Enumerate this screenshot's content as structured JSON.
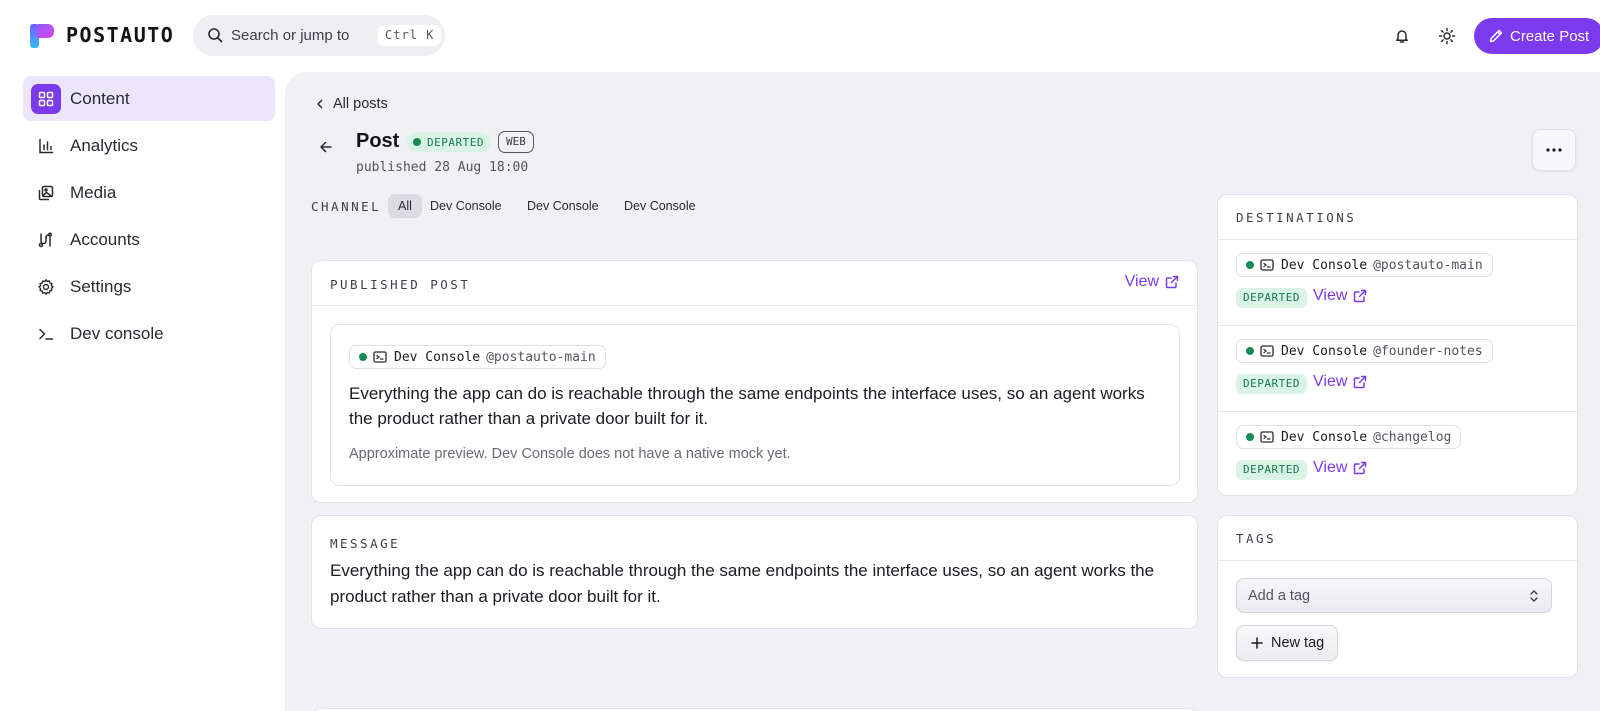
{
  "app": {
    "name": "POSTAUTO"
  },
  "search": {
    "placeholder": "Search or jump to",
    "shortcut": "Ctrl K"
  },
  "header": {
    "create_label": "Create Post",
    "accent": "#7c3aed"
  },
  "sidebar": {
    "items": [
      {
        "label": "Content",
        "icon": "grid-icon",
        "active": true
      },
      {
        "label": "Analytics",
        "icon": "bar-chart-icon"
      },
      {
        "label": "Media",
        "icon": "images-icon"
      },
      {
        "label": "Accounts",
        "icon": "accounts-icon"
      },
      {
        "label": "Settings",
        "icon": "gear-icon"
      },
      {
        "label": "Dev console",
        "icon": "terminal-icon"
      }
    ]
  },
  "post": {
    "breadcrumb": "All posts",
    "title": "Post",
    "status": "DEPARTED",
    "source": "WEB",
    "published": "published 28 Aug 18:00"
  },
  "channel": {
    "label": "CHANNEL",
    "filters": [
      "All",
      "Dev Console",
      "Dev Console",
      "Dev Console"
    ],
    "active": "All"
  },
  "published_post": {
    "label": "PUBLISHED POST",
    "view_label": "View",
    "account": {
      "name": "Dev Console",
      "handle": "@postauto-main"
    },
    "body": "Everything the app can do is reachable through the same endpoints the interface uses, so an agent works the product rather than a private door built for it.",
    "note": "Approximate preview. Dev Console does not have a native mock yet."
  },
  "message": {
    "label": "MESSAGE",
    "body": "Everything the app can do is reachable through the same endpoints the interface uses, so an agent works the product rather than a private door built for it."
  },
  "destinations": {
    "label": "DESTINATIONS",
    "items": [
      {
        "name": "Dev Console",
        "handle": "@postauto-main",
        "status": "DEPARTED",
        "view": "View"
      },
      {
        "name": "Dev Console",
        "handle": "@founder-notes",
        "status": "DEPARTED",
        "view": "View"
      },
      {
        "name": "Dev Console",
        "handle": "@changelog",
        "status": "DEPARTED",
        "view": "View"
      }
    ]
  },
  "tags": {
    "label": "TAGS",
    "placeholder": "Add a tag",
    "new_label": "New tag"
  }
}
